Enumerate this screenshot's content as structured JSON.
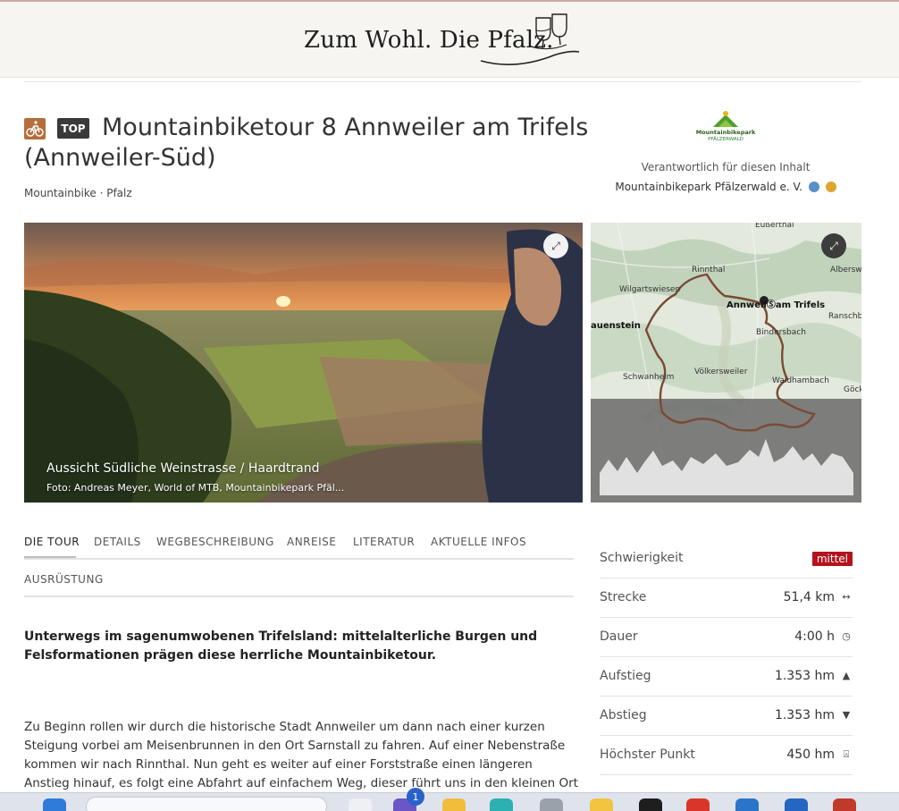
{
  "site": {
    "brand": "Zum Wohl. Die Pfalz."
  },
  "tour": {
    "badge": "TOP",
    "title": "Mountainbiketour 8 Annweiler am Trifels (Annweiler-Süd)",
    "category": "Mountainbike · Pfalz",
    "activity_icon": "mountainbike-icon"
  },
  "partner": {
    "logo_text": "Mountainbikepark",
    "logo_subtext": "PFÄLZERWALD",
    "responsible_label": "Verantwortlich für diesen Inhalt",
    "responsible_name": "Mountainbikepark Pfälzerwald e. V."
  },
  "hero": {
    "caption": "Aussicht Südliche Weinstrasse / Haardtrand",
    "credit": "Foto: Andreas Meyer, World of MTB, Mountainbikepark Pfäl..."
  },
  "map": {
    "labels": {
      "eußerthal": "Eußerthal",
      "rinnthal": "Rinnthal",
      "albersweiler": "Albersweil",
      "wilgartswiesen": "Wilgartswiesen",
      "annweiler": "AnnweilⓈam Trifels",
      "ranschbach": "Ranschbach",
      "hauenstein": "auenstein",
      "bindersbach": "Bindersbach",
      "schwanheim": "Schwanheim",
      "voelkersweiler": "Völkersweiler",
      "waldhambach": "Waldhambach",
      "goecklingen": "Göckli"
    }
  },
  "tabs": {
    "row1": [
      "DIE TOUR",
      "DETAILS",
      "WEGBESCHREIBUNG",
      "ANREISE",
      "LITERATUR",
      "AKTUELLE INFOS"
    ],
    "row2": [
      "AUSRÜSTUNG"
    ]
  },
  "content": {
    "lead": "Unterwegs im sagenumwobenen Trifelsland: mittelalterliche Burgen und Felsformationen prägen diese herrliche Mountainbiketour.",
    "body": "Zu Beginn rollen wir durch die historische Stadt Annweiler um dann nach einer kurzen Steigung vorbei am Meisenbrunnen in den Ort Sarnstall zu fahren. Auf einer Nebenstraße kommen wir nach Rinnthal. Nun geht es weiter auf einer Forststraße einen längeren Anstieg hinauf, es folgt eine Abfahrt auf einfachem Weg, dieser führt uns in den kleinen Ort"
  },
  "facts": {
    "difficulty_label": "Schwierigkeit",
    "difficulty_value": "mittel",
    "distance_label": "Strecke",
    "distance_value": "51,4 km",
    "duration_label": "Dauer",
    "duration_value": "4:00 h",
    "ascent_label": "Aufstieg",
    "ascent_value": "1.353 hm",
    "descent_label": "Abstieg",
    "descent_value": "1.353 hm",
    "highest_label": "Höchster Punkt",
    "highest_value": "450 hm"
  },
  "colors": {
    "difficulty": "#b5121b",
    "activity_icon_bg": "#b56d3c",
    "route": "#7a4a34"
  }
}
